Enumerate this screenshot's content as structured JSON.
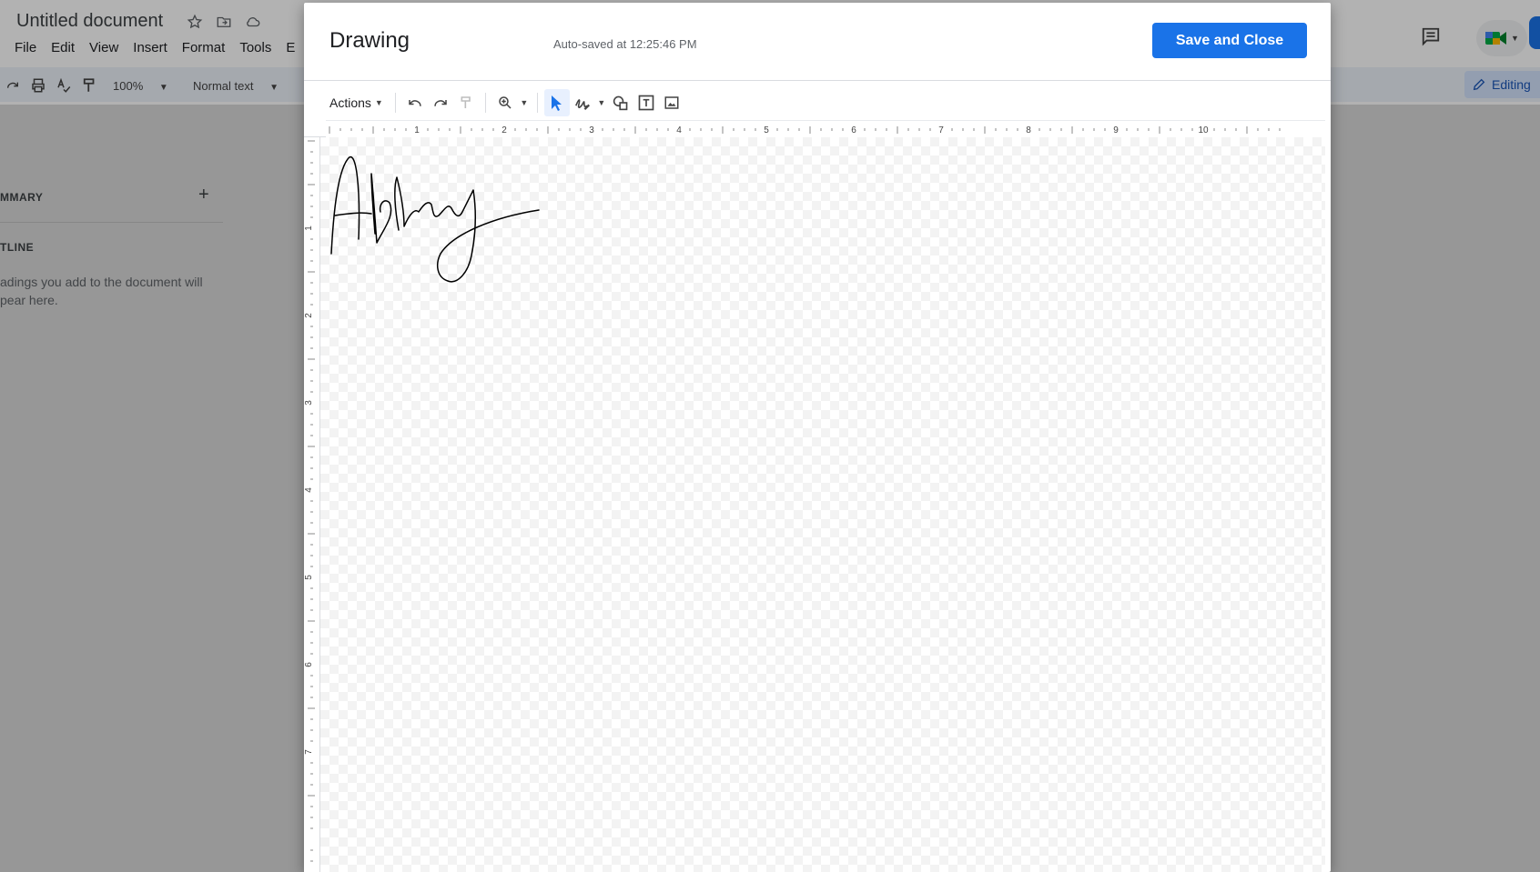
{
  "docs": {
    "title": "Untitled document",
    "menu": [
      "File",
      "Edit",
      "View",
      "Insert",
      "Format",
      "Tools",
      "E"
    ],
    "zoom": "100%",
    "style": "Normal text",
    "editing_label": "Editing",
    "outline": {
      "summary_label": "MMARY",
      "outline_label": "TLINE",
      "hint": "adings you add to the document will pear here."
    }
  },
  "dialog": {
    "title": "Drawing",
    "autosave": "Auto-saved at 12:25:46 PM",
    "save_label": "Save and Close",
    "toolbar": {
      "actions_label": "Actions"
    },
    "ruler_h": [
      "1",
      "2",
      "3",
      "4",
      "5",
      "6",
      "7",
      "8",
      "9",
      "10"
    ],
    "ruler_v": [
      "1",
      "2",
      "3",
      "4",
      "5",
      "6",
      "7"
    ]
  },
  "colors": {
    "accent": "#1a73e8",
    "stroke": "#000000"
  }
}
